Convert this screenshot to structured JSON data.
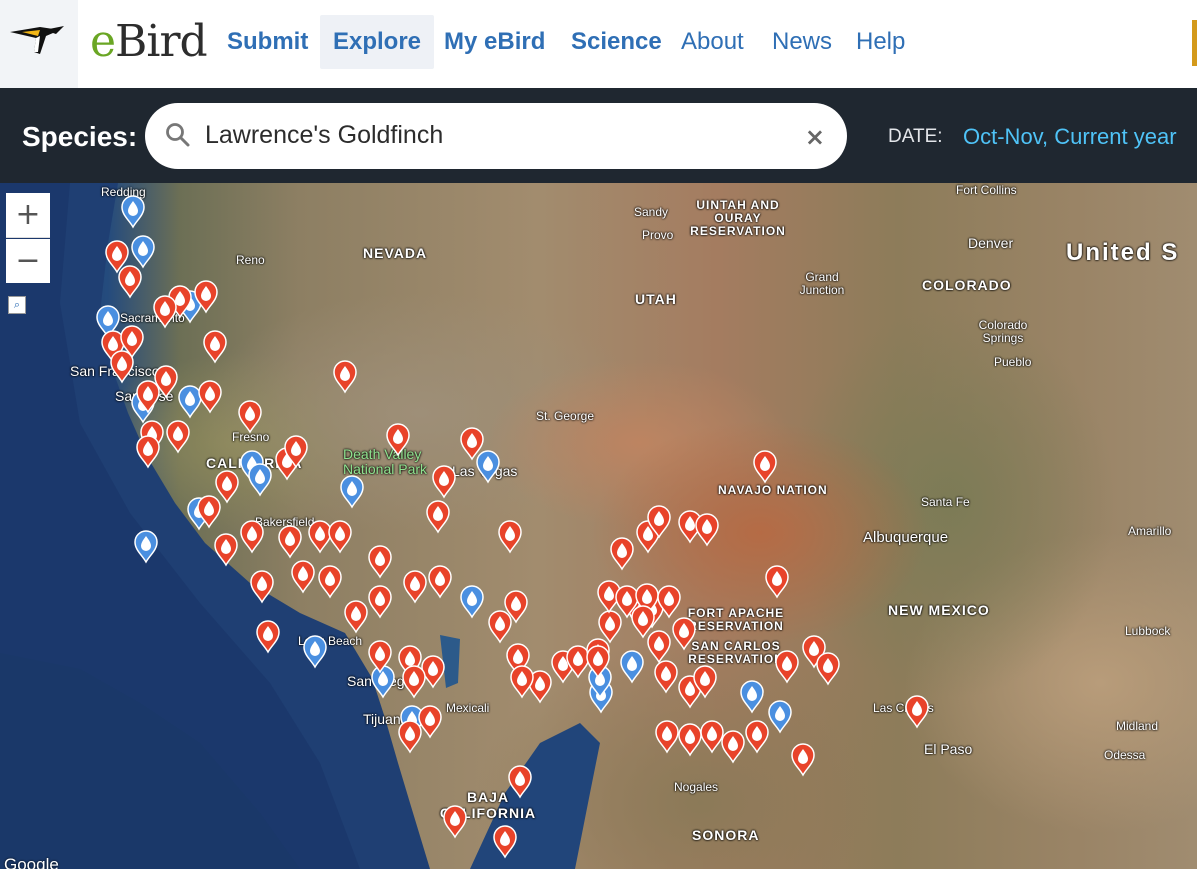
{
  "header": {
    "brand_e": "e",
    "brand_rest": "Bird",
    "nav": [
      "Submit",
      "Explore",
      "My eBird",
      "Science",
      "About",
      "News",
      "Help"
    ]
  },
  "search": {
    "label": "Species:",
    "value": "Lawrence's Goldfinch",
    "clear": "×",
    "date_label": "DATE:",
    "date_value": "Oct-Nov,  Current year"
  },
  "map": {
    "zoom_in": "+",
    "zoom_out": "−",
    "attribution": "Google",
    "places": [
      "Redding",
      "Reno",
      "NEVADA",
      "Sacramento",
      "San Francisco",
      "San Jose",
      "Fresno",
      "CALIFORNIA",
      "Bakersfield",
      "Death Valley National Park",
      "Las Vegas",
      "Long Beach",
      "San Diego",
      "Tijuana",
      "Mexicali",
      "BAJA CALIFORNIA",
      "Nogales",
      "SONORA",
      "St. George",
      "UTAH",
      "Sandy",
      "Provo",
      "UINTAH AND OURAY RESERVATION",
      "Grand Junction",
      "Denver",
      "Fort Collins",
      "COLORADO",
      "Colorado Springs",
      "Pueblo",
      "United S",
      "NAVAJO NATION",
      "Santa Fe",
      "Albuquerque",
      "Amarillo",
      "NEW MEXICO",
      "Lubbock",
      "FORT APACHE RESERVATION",
      "SAN CARLOS RESERVATION",
      "Las Cruces",
      "El Paso",
      "Midland",
      "Odessa"
    ],
    "pin_colors": {
      "recent": "#e8432a",
      "older": "#4a8fe0"
    }
  }
}
